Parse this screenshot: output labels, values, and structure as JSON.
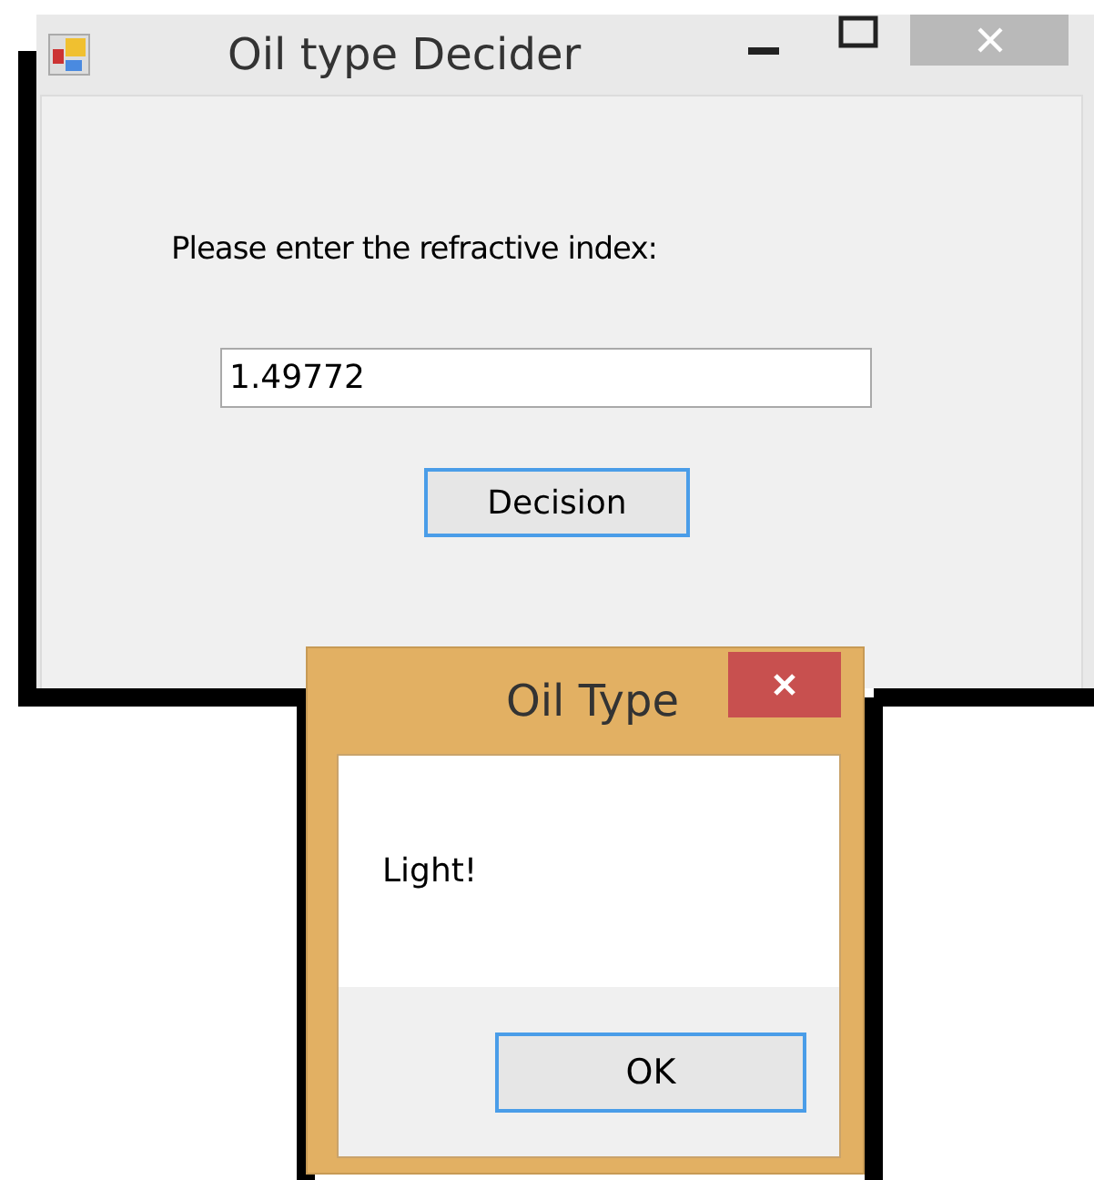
{
  "main_window": {
    "title": "Oil type Decider",
    "prompt": "Please enter the refractive index:",
    "input": {
      "value": "1.49772"
    },
    "button": "Decision"
  },
  "dialog": {
    "title": "Oil Type",
    "message": "Light!",
    "button": "OK"
  }
}
